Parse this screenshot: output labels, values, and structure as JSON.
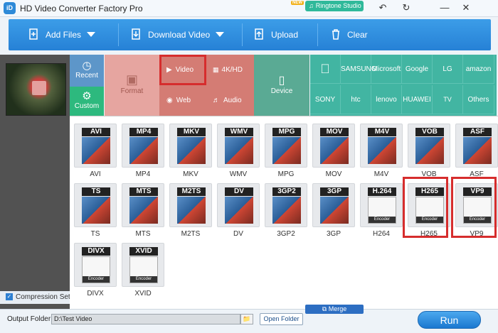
{
  "window": {
    "title": "HD Video Converter Factory Pro",
    "logo_text": "iD",
    "new_badge": "NEW",
    "ringtone_label": "Ringtone Studio"
  },
  "toolbar": {
    "add_files": "Add Files",
    "download_video": "Download Video",
    "upload": "Upload",
    "clear": "Clear"
  },
  "categories": {
    "recent": "Recent",
    "custom": "Custom",
    "format": "Format",
    "video": "Video",
    "fourk": "4K/HD",
    "web": "Web",
    "audio": "Audio",
    "device": "Device"
  },
  "brands": [
    "",
    "SAMSUNG",
    "Microsoft",
    "Google",
    "LG",
    "amazon",
    "SONY",
    "htc",
    "lenovo",
    "HUAWEI",
    "TV",
    "Others"
  ],
  "brand_icons": [
    "apple-icon",
    "samsung-logo",
    "microsoft-logo",
    "google-logo",
    "lg-logo",
    "amazon-logo",
    "sony-logo",
    "htc-logo",
    "lenovo-logo",
    "huawei-logo",
    "tv-icon",
    "others-label"
  ],
  "formats": [
    {
      "head": "AVI",
      "label": "AVI",
      "enc": ""
    },
    {
      "head": "MP4",
      "label": "MP4",
      "enc": ""
    },
    {
      "head": "MKV",
      "label": "MKV",
      "enc": ""
    },
    {
      "head": "WMV",
      "label": "WMV",
      "enc": ""
    },
    {
      "head": "MPG",
      "label": "MPG",
      "enc": ""
    },
    {
      "head": "MOV",
      "label": "MOV",
      "enc": ""
    },
    {
      "head": "M4V",
      "label": "M4V",
      "enc": ""
    },
    {
      "head": "VOB",
      "label": "VOB",
      "enc": ""
    },
    {
      "head": "ASF",
      "label": "ASF",
      "enc": ""
    },
    {
      "head": "TS",
      "label": "TS",
      "enc": ""
    },
    {
      "head": "MTS",
      "label": "MTS",
      "enc": ""
    },
    {
      "head": "M2TS",
      "label": "M2TS",
      "enc": ""
    },
    {
      "head": "DV",
      "label": "DV",
      "enc": ""
    },
    {
      "head": "3GP2",
      "label": "3GP2",
      "enc": ""
    },
    {
      "head": "3GP",
      "label": "3GP",
      "enc": ""
    },
    {
      "head": "H.264",
      "label": "H264",
      "enc": "Encoder"
    },
    {
      "head": "H265",
      "label": "H265",
      "enc": "Encoder"
    },
    {
      "head": "VP9",
      "label": "VP9",
      "enc": "Encoder"
    },
    {
      "head": "DIVX",
      "label": "DIVX",
      "enc": "Encoder"
    },
    {
      "head": "XVID",
      "label": "XVID",
      "enc": "Encoder"
    }
  ],
  "compression": "Compression Settings",
  "bottom": {
    "output_label": "Output Folder:",
    "output_value": "D:\\Test Video",
    "open_folder": "Open Folder",
    "merge": "Merge",
    "run": "Run"
  }
}
